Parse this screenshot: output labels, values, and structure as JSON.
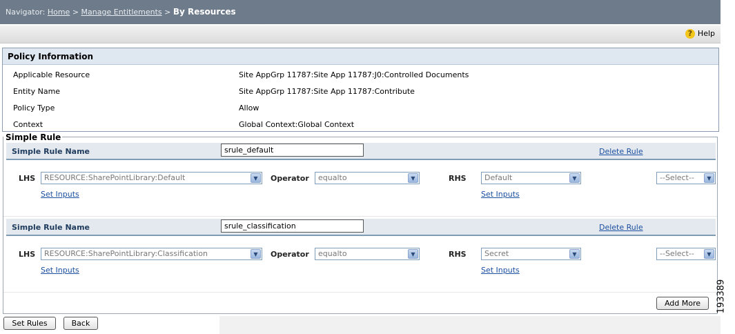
{
  "navigator": {
    "label": "Navigator:",
    "home": "Home",
    "sep": ">",
    "manage": "Manage Entitlements",
    "current": "By Resources"
  },
  "help": {
    "label": "Help",
    "icon": "help-question-icon"
  },
  "policy": {
    "title": "Policy Information",
    "rows": [
      {
        "label": "Applicable Resource",
        "value": "Site AppGrp 11787:Site App 11787:J0:Controlled Documents"
      },
      {
        "label": "Entity Name",
        "value": "Site AppGrp 11787:Site App 11787:Contribute"
      },
      {
        "label": "Policy Type",
        "value": "Allow"
      },
      {
        "label": "Context",
        "value": "Global Context:Global Context"
      }
    ]
  },
  "simple_rule": {
    "legend": "Simple Rule",
    "rules": [
      {
        "name_label": "Simple Rule Name",
        "name_value": "srule_default",
        "delete": "Delete Rule",
        "lhs_label": "LHS",
        "lhs_value": "RESOURCE:SharePointLibrary:Default",
        "operator_label": "Operator",
        "operator_value": "equalto",
        "rhs_label": "RHS",
        "rhs_value": "Default",
        "extra_value": "--Select--",
        "lhs_set_inputs": "Set Inputs",
        "rhs_set_inputs": "Set Inputs"
      },
      {
        "name_label": "Simple Rule Name",
        "name_value": "srule_classification",
        "delete": "Delete Rule",
        "lhs_label": "LHS",
        "lhs_value": "RESOURCE:SharePointLibrary:Classification",
        "operator_label": "Operator",
        "operator_value": "equalto",
        "rhs_label": "RHS",
        "rhs_value": "Secret",
        "extra_value": "--Select--",
        "lhs_set_inputs": "Set Inputs",
        "rhs_set_inputs": "Set Inputs"
      }
    ],
    "add_more": "Add More"
  },
  "buttons": {
    "set_rules": "Set Rules",
    "back": "Back"
  },
  "figure_id": "193389",
  "colors": {
    "nav_bg": "#6d7b8a",
    "section_header": "#dfe7f1",
    "link": "#1b4fa0"
  }
}
